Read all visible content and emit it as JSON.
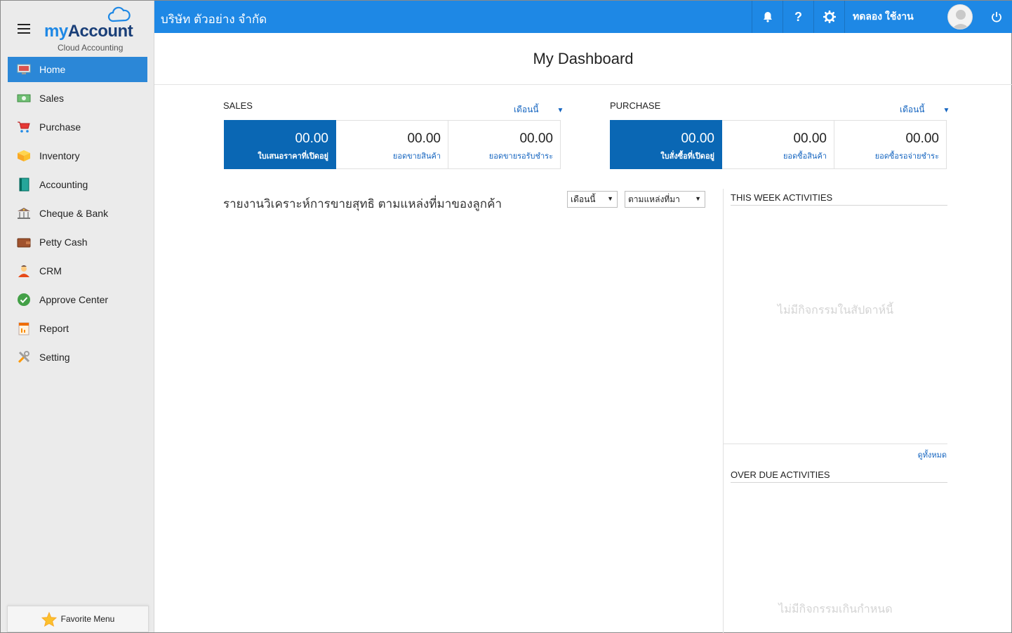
{
  "brand": {
    "name_part1": "my",
    "name_part2": "Account",
    "subtitle": "Cloud Accounting"
  },
  "sidebar": {
    "items": [
      {
        "label": "Home",
        "icon": "home-monitor-icon",
        "active": true
      },
      {
        "label": "Sales",
        "icon": "cash-icon"
      },
      {
        "label": "Purchase",
        "icon": "shopping-cart-icon"
      },
      {
        "label": "Inventory",
        "icon": "box-icon"
      },
      {
        "label": "Accounting",
        "icon": "ledger-book-icon"
      },
      {
        "label": "Cheque & Bank",
        "icon": "bank-icon"
      },
      {
        "label": "Petty Cash",
        "icon": "wallet-icon"
      },
      {
        "label": "CRM",
        "icon": "person-icon"
      },
      {
        "label": "Approve Center",
        "icon": "check-circle-icon"
      },
      {
        "label": "Report",
        "icon": "report-icon"
      },
      {
        "label": "Setting",
        "icon": "tools-icon"
      }
    ],
    "favorite_label": "Favorite Menu"
  },
  "topbar": {
    "company": "บริษัท ตัวอย่าง จำกัด",
    "help_label": "?",
    "user_name": "ทดลอง ใช้งาน",
    "color": "#1e88e5"
  },
  "main": {
    "title": "My Dashboard",
    "sales": {
      "label": "SALES",
      "period": "เดือนนี้",
      "cards": [
        {
          "value": "00.00",
          "label": "ใบเสนอราคาที่เปิดอยู่"
        },
        {
          "value": "00.00",
          "label": "ยอดขายสินค้า"
        },
        {
          "value": "00.00",
          "label": "ยอดขายรอรับชำระ"
        }
      ]
    },
    "purchase": {
      "label": "PURCHASE",
      "period": "เดือนนี้",
      "cards": [
        {
          "value": "00.00",
          "label": "ใบสั่งซื้อที่เปิดอยู่"
        },
        {
          "value": "00.00",
          "label": "ยอดซื้อสินค้า"
        },
        {
          "value": "00.00",
          "label": "ยอดซื้อรอจ่ายชำระ"
        }
      ]
    },
    "report": {
      "title": "รายงานวิเคราะห์การขายสุทธิ ตามแหล่งที่มาของลูกค้า",
      "period_select": "เดือนนี้",
      "source_select": "ตามแหล่งที่มา"
    },
    "activities": {
      "week_title": "THIS WEEK ACTIVITIES",
      "week_empty": "ไม่มีกิจกรรมในสัปดาห์นี้",
      "see_all": "ดูทั้งหมด",
      "overdue_title": "OVER DUE ACTIVITIES",
      "overdue_empty": "ไม่มีกิจกรรมเกินกำหนด"
    }
  }
}
